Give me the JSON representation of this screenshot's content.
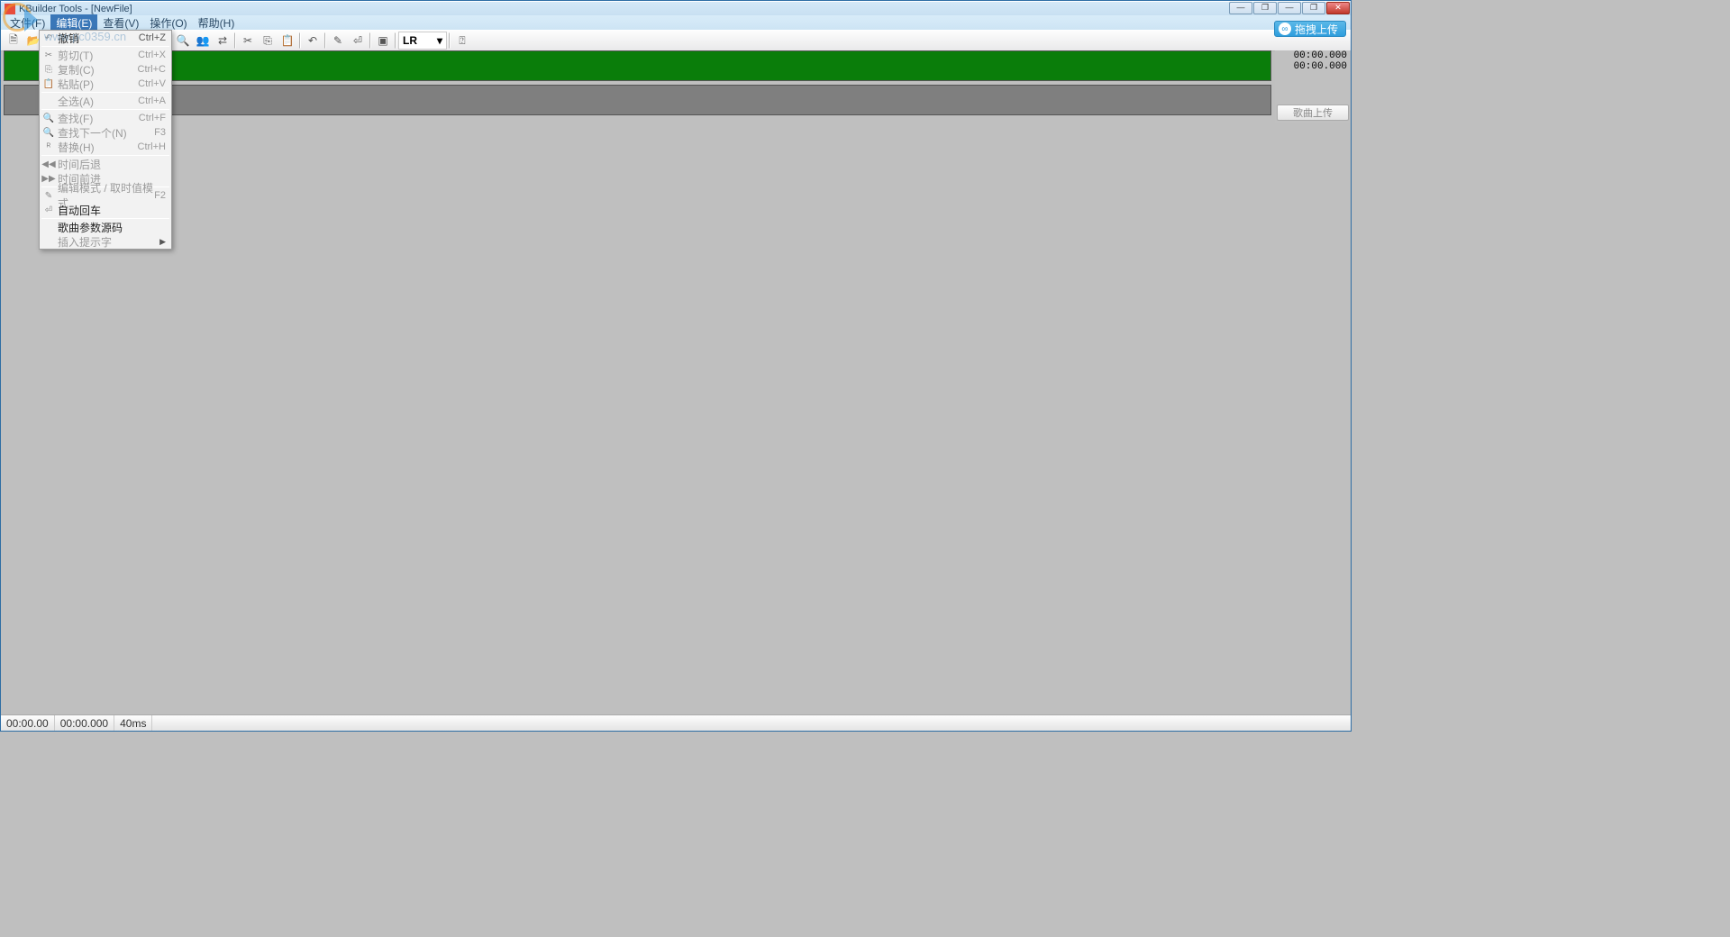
{
  "window": {
    "title": "KBuilder Tools - [NewFile]"
  },
  "watermark": "www.pc0359.cn",
  "menubar": {
    "file": "文件(F)",
    "edit": "编辑(E)",
    "view": "查看(V)",
    "action": "操作(O)",
    "help": "帮助(H)"
  },
  "toolbar": {
    "lr_label": "LR",
    "upload_text": "拖拽上传"
  },
  "right_panel": {
    "time1": "00:00.000",
    "time2": "00:00.000",
    "upload_song": "歌曲上传"
  },
  "dropdown": {
    "items": [
      {
        "label": "撤销",
        "shortcut": "Ctrl+Z",
        "icon": "↶",
        "enabled": true
      },
      {
        "sep": true
      },
      {
        "label": "剪切(T)",
        "shortcut": "Ctrl+X",
        "icon": "✂",
        "enabled": false
      },
      {
        "label": "复制(C)",
        "shortcut": "Ctrl+C",
        "icon": "⎘",
        "enabled": false
      },
      {
        "label": "粘贴(P)",
        "shortcut": "Ctrl+V",
        "icon": "📋",
        "enabled": false
      },
      {
        "sep": true
      },
      {
        "label": "全选(A)",
        "shortcut": "Ctrl+A",
        "icon": "",
        "enabled": false
      },
      {
        "sep": true
      },
      {
        "label": "查找(F)",
        "shortcut": "Ctrl+F",
        "icon": "🔍",
        "enabled": false
      },
      {
        "label": "查找下一个(N)",
        "shortcut": "F3",
        "icon": "🔍",
        "enabled": false
      },
      {
        "label": "替换(H)",
        "shortcut": "Ctrl+H",
        "icon": "ᴿ",
        "enabled": false
      },
      {
        "sep": true
      },
      {
        "label": "时间后退",
        "shortcut": "",
        "icon": "◀◀",
        "enabled": false
      },
      {
        "label": "时间前进",
        "shortcut": "",
        "icon": "▶▶",
        "enabled": false
      },
      {
        "sep": true
      },
      {
        "label": "编辑模式 / 取时值模式",
        "shortcut": "F2",
        "icon": "✎",
        "enabled": false
      },
      {
        "label": "自动回车",
        "shortcut": "",
        "icon": "⏎",
        "enabled": true
      },
      {
        "sep": true
      },
      {
        "label": "歌曲参数源码",
        "shortcut": "",
        "icon": "",
        "enabled": true
      },
      {
        "label": "插入提示字",
        "shortcut": "",
        "icon": "",
        "enabled": false,
        "arrow": true
      }
    ]
  },
  "statusbar": {
    "cell1": "00:00.00",
    "cell2": "00:00.000",
    "cell3": "40ms"
  }
}
